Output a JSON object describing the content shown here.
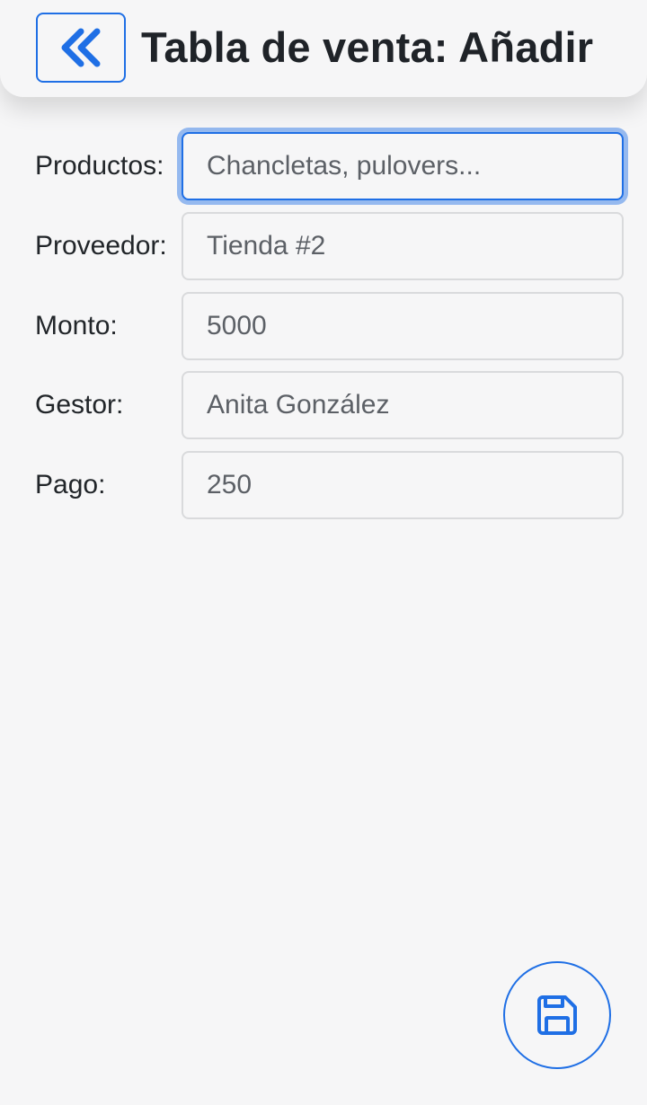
{
  "header": {
    "title": "Tabla de venta: Añadir",
    "back_icon": "double-chevron-left-icon"
  },
  "form": {
    "fields": [
      {
        "label": "Productos:",
        "value": "",
        "placeholder": "Chancletas, pulovers...",
        "focused": true
      },
      {
        "label": "Proveedor:",
        "value": "",
        "placeholder": "Tienda #2",
        "focused": false
      },
      {
        "label": "Monto:",
        "value": "",
        "placeholder": "5000",
        "focused": false
      },
      {
        "label": "Gestor:",
        "value": "",
        "placeholder": "Anita González",
        "focused": false
      },
      {
        "label": "Pago:",
        "value": "",
        "placeholder": "250",
        "focused": false
      }
    ]
  },
  "actions": {
    "save_icon": "floppy-disk-icon"
  },
  "colors": {
    "accent": "#1f6fe5",
    "background": "#f6f6f7",
    "input_border": "#d9dadc",
    "text": "#1f2328"
  }
}
